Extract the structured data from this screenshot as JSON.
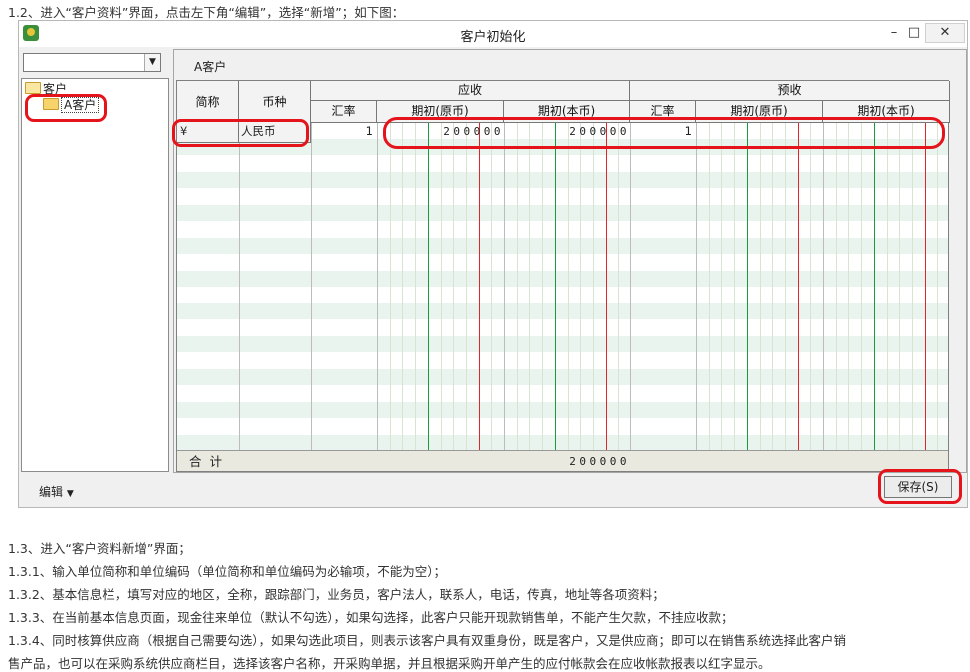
{
  "doc": {
    "top_line": "1.2、进入“客户资料”界面，点击左下角“编辑”，选择“新增”；如下图：",
    "lines": [
      "1.3、进入“客户资料新增”界面；",
      "1.3.1、输入单位简称和单位编码（单位简称和单位编码为必输项，不能为空）；",
      "1.3.2、基本信息栏，填写对应的地区，全称，跟踪部门，业务员，客户法人，联系人，电话，传真，地址等各项资料；",
      "1.3.3、在当前基本信息页面，现金往来单位（默认不勾选），如果勾选择，此客户只能开现款销售单，不能产生欠款，不挂应收款；",
      "1.3.4、同时核算供应商（根据自己需要勾选），如果勾选此项目，则表示该客户具有双重身份，既是客户，又是供应商；即可以在销售系统选择此客户销",
      "售产品，也可以在采购系统供应商栏目，选择该客户名称，开采购单据，并且根据采购开单产生的应付帐款会在应收帐款报表以红字显示。"
    ]
  },
  "window": {
    "title": "客户初始化",
    "minimize": "–",
    "maximize": "□",
    "close": "✕"
  },
  "tree": {
    "combo_value": "",
    "root": "客户",
    "child": "A客户"
  },
  "pane": {
    "customer_label": "A客户"
  },
  "grid": {
    "headers": {
      "short_name": "简称",
      "currency": "币种",
      "receivable": "应收",
      "prepaid": "预收",
      "rate": "汇率",
      "opening_original": "期初(原币)",
      "opening_local": "期初(本币)"
    },
    "row1": {
      "short_name": "¥",
      "currency": "人民币",
      "rate": "1",
      "receivable_original": "200000",
      "receivable_local": "200000",
      "prepaid_rate": "1"
    },
    "total": {
      "label": "合 计",
      "receivable_local": "200000"
    }
  },
  "bottom": {
    "edit_label": "编辑",
    "save_label": "保存(S)"
  },
  "colors": {
    "callout": "#e5141b",
    "grid_green": "#1a9a3a",
    "grid_red": "#e0262b"
  }
}
